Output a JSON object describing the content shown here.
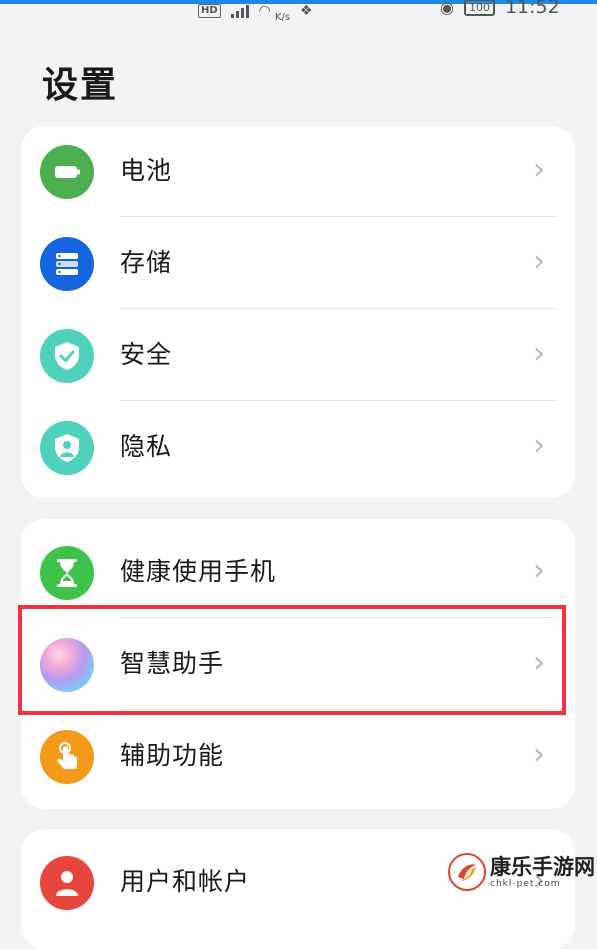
{
  "status_bar": {
    "hd": "HD",
    "speed": "K/s",
    "time": "11:52",
    "battery": "100"
  },
  "page": {
    "title": "设置"
  },
  "groups": [
    {
      "items": [
        {
          "label": "电池",
          "icon": "battery-icon",
          "color": "#4caf50"
        },
        {
          "label": "存储",
          "icon": "storage-icon",
          "color": "#1565e0"
        },
        {
          "label": "安全",
          "icon": "security-shield-icon",
          "color": "#4fd1bb"
        },
        {
          "label": "隐私",
          "icon": "privacy-shield-icon",
          "color": "#4fd1bb"
        }
      ]
    },
    {
      "items": [
        {
          "label": "健康使用手机",
          "icon": "hourglass-icon",
          "color": "#3ec34a"
        },
        {
          "label": "智慧助手",
          "icon": "smart-assistant-icon",
          "color": "#c9a8f0",
          "highlighted": true
        },
        {
          "label": "辅助功能",
          "icon": "accessibility-hand-icon",
          "color": "#f59a1b"
        }
      ]
    },
    {
      "items": [
        {
          "label": "用户和帐户",
          "icon": "user-icon",
          "color": "#e8453c"
        }
      ]
    }
  ],
  "chevron": "›",
  "watermark": {
    "name": "康乐手游网",
    "url": "chkl-pet.com"
  },
  "colors": {
    "background": "#f1f3f5",
    "card": "#ffffff",
    "highlight_border": "#ef3340",
    "chevron": "#b9b9b9",
    "accent_top": "#1e88e5"
  }
}
